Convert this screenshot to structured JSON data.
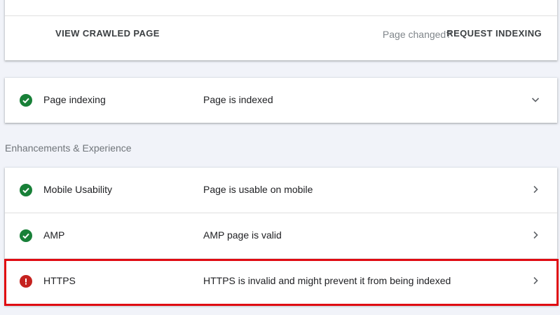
{
  "top_actions": {
    "view_crawled_label": "VIEW CRAWLED PAGE",
    "page_changed_text": "Page changed?",
    "request_indexing_label": "REQUEST INDEXING"
  },
  "indexing": {
    "label": "Page indexing",
    "value": "Page is indexed",
    "status": "ok",
    "chevron": "chevron-down-icon"
  },
  "section_title": "Enhancements & Experience",
  "enhancements": [
    {
      "label": "Mobile Usability",
      "value": "Page is usable on mobile",
      "status": "ok",
      "chevron": "chevron-right-icon"
    },
    {
      "label": "AMP",
      "value": "AMP page is valid",
      "status": "ok",
      "chevron": "chevron-right-icon"
    },
    {
      "label": "HTTPS",
      "value": "HTTPS is invalid and might prevent it from being indexed",
      "status": "error",
      "chevron": "chevron-right-icon"
    }
  ],
  "colors": {
    "ok": "#188038",
    "error": "#c5221f",
    "highlight": "#e00b12",
    "background": "#f1f3f9"
  }
}
